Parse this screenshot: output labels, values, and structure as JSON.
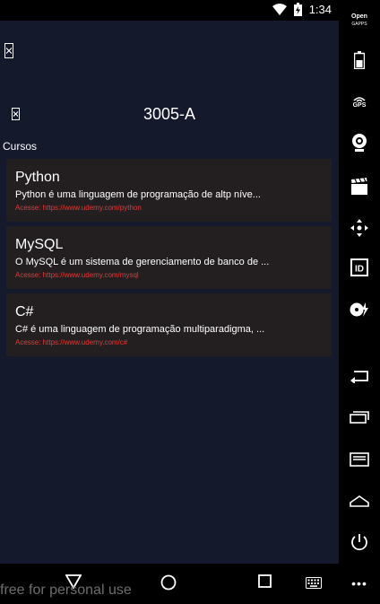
{
  "status_bar": {
    "time": "1:34",
    "icons": [
      "wifi-icon",
      "battery-icon"
    ]
  },
  "app": {
    "menu_icon": "menu-icon",
    "back_icon": "back-icon",
    "title": "3005-A",
    "section_label": "Cursos",
    "courses": [
      {
        "name": "Python",
        "description": "Python é uma linguagem de programação de altp níve...",
        "link": "Acesse: https://www.udemy.com/python"
      },
      {
        "name": "MySQL",
        "description": "O MySQL é um sistema de gerenciamento de banco de ...",
        "link": "Acesse: https://www.udemy.com/mysql"
      },
      {
        "name": "C#",
        "description": "C# é uma linguagem de programação multiparadigma, ...",
        "link": "Acesse: https://www.udemy.com/c#"
      }
    ]
  },
  "nav_bar": {
    "buttons": [
      "back-triangle-icon",
      "home-circle-icon",
      "recents-square-icon",
      "keyboard-icon"
    ]
  },
  "watermark": "free for personal use",
  "side_panel": {
    "opengapps_line1": "Open",
    "opengapps_line2": "GAPPS",
    "gps_label": "GPS",
    "id_label": "ID",
    "more_label": "•••"
  }
}
